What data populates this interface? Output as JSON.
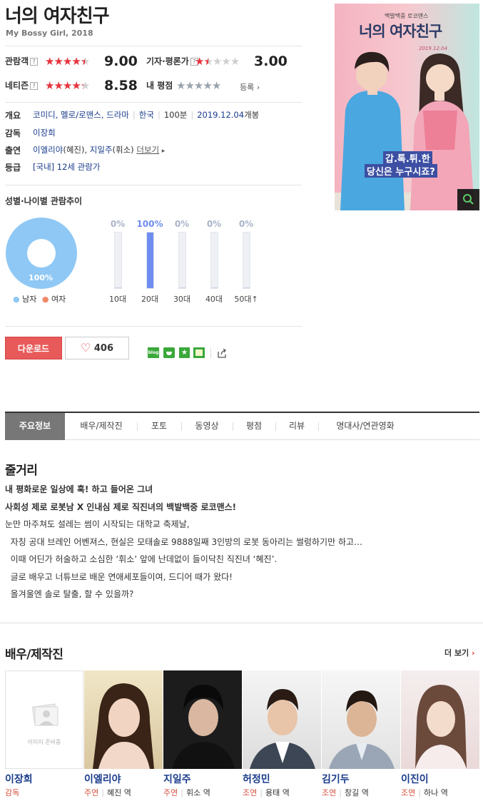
{
  "movie": {
    "title": "너의 여자친구",
    "subtitle": "My Bossy Girl, 2018"
  },
  "ratings": {
    "audience": {
      "label": "관람객",
      "score": "9.00",
      "stars": 4.5
    },
    "critic": {
      "label": "기자·평론가",
      "score": "3.00",
      "stars": 1.5
    },
    "netizen": {
      "label": "네티즌",
      "score": "8.58",
      "stars": 4.3
    },
    "mine": {
      "label": "내 평점",
      "register": "등록",
      "stars": 0
    },
    "help": "?",
    "colors": {
      "filled": "#e8333d",
      "empty": "#cfcfcf",
      "mine": "#9aa3ad"
    }
  },
  "info": {
    "overview_label": "개요",
    "genre": "코미디, 멜로/로맨스, 드라마",
    "country": "한국",
    "runtime": "100분",
    "release": "2019.12.04",
    "release_suffix": "개봉",
    "director_label": "감독",
    "director": "이장희",
    "cast_label": "출연",
    "cast": "이엘리야",
    "cast_role": "(혜진),",
    "cast2": "지일주",
    "cast2_role": "(휘소)",
    "cast_more": "더보기",
    "grade_label": "등급",
    "grade": "[국내] 12세 관람가"
  },
  "poster": {
    "tagline": "백발백중 로코맨스",
    "title": "너의 여자친구",
    "date": "2019.12.04",
    "caption1": "갑.톡.튀.한",
    "caption2": "당신은 누구시죠?",
    "zoom_icon": "search-icon"
  },
  "demographics": {
    "title": "성별·나이별 관람추이",
    "pie_label": "100%",
    "male_share": 100,
    "legend_male": "남자",
    "legend_female": "여자",
    "male_color": "#8fc8f5",
    "female_color": "#f08a6a",
    "ages": [
      {
        "label": "10대",
        "pct_text": "0%",
        "pct": 0
      },
      {
        "label": "20대",
        "pct_text": "100%",
        "pct": 100
      },
      {
        "label": "30대",
        "pct_text": "0%",
        "pct": 0
      },
      {
        "label": "40대",
        "pct_text": "0%",
        "pct": 0
      },
      {
        "label": "50대↑",
        "pct_text": "0%",
        "pct": 0
      }
    ]
  },
  "actions": {
    "download": "다운로드",
    "likes": "406",
    "share_icons": [
      "blog-icon",
      "cafe-icon",
      "bookmark-icon",
      "me2day-icon",
      "share-icon"
    ],
    "blog_label": "blog"
  },
  "tabs": [
    "주요정보",
    "배우/제작진",
    "포토",
    "동영상",
    "평점",
    "리뷰",
    "명대사/연관영화"
  ],
  "synopsis": {
    "heading": "줄거리",
    "bold1": "내 평화로운 일상에 훅! 하고 들어온 그녀",
    "bold2": "사회성 제로 로봇남 X 인내심 제로 직진녀의 백발백중 로코맨스!",
    "lines": [
      "눈만 마주쳐도 설레는 썸이 시작되는 대학교 축제날,",
      "  자칭 공대 브레인 어벤져스, 현실은 모태솔로 9888일째 3인방의 로봇 동아리는 썰렁하기만 하고…",
      "  이때 어딘가 허술하고 소심한 ‘휘소’ 앞에 난데없이 들이닥친 직진녀 ‘혜진’.",
      "  글로 배우고 너튜브로 배운 연애세포들이여, 드디어 때가 왔다!",
      "  올겨울엔 솔로 탈출, 할 수 있을까?"
    ]
  },
  "crew": {
    "heading": "배우/제작진",
    "more": "더 보기",
    "placeholder_text": "이미지 준비중",
    "members": [
      {
        "name": "이장희",
        "role": "감독",
        "character": ""
      },
      {
        "name": "이엘리야",
        "role": "주연",
        "character": "혜진 역"
      },
      {
        "name": "지일주",
        "role": "주연",
        "character": "휘소 역"
      },
      {
        "name": "허정민",
        "role": "조연",
        "character": "용태 역"
      },
      {
        "name": "김기두",
        "role": "조연",
        "character": "창길 역"
      },
      {
        "name": "이진이",
        "role": "조연",
        "character": "하나 역"
      }
    ]
  }
}
